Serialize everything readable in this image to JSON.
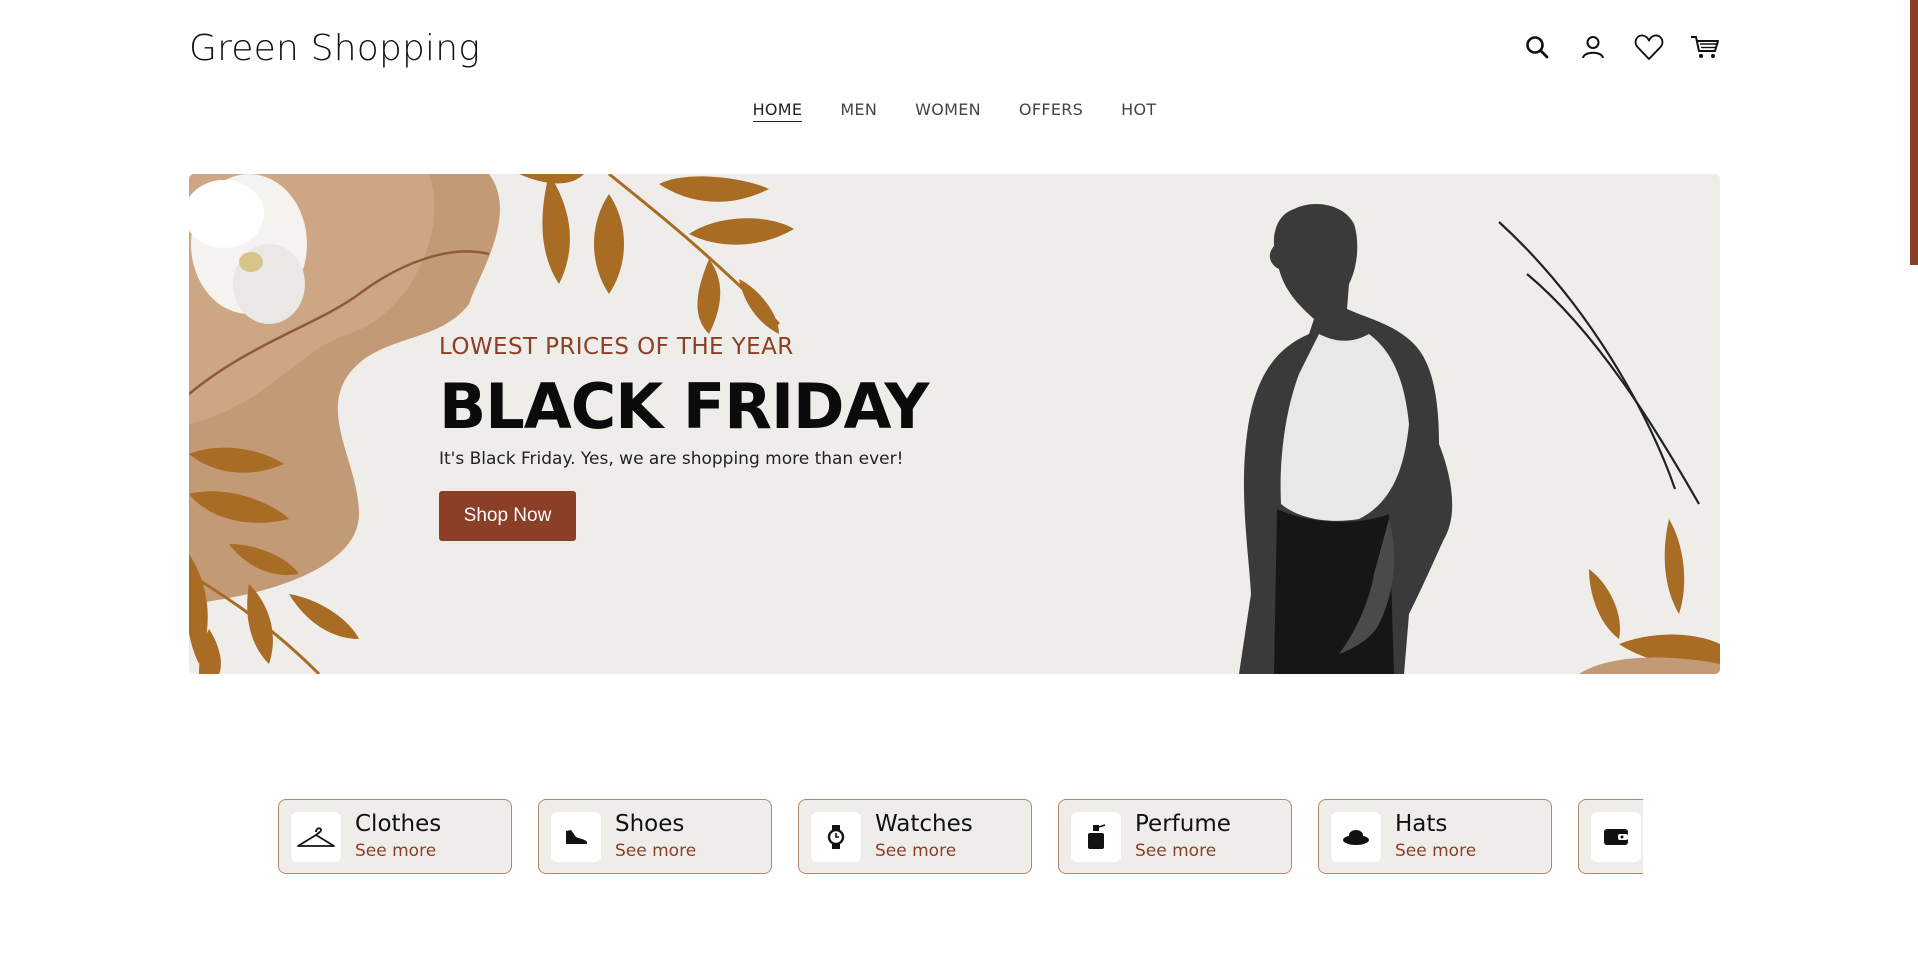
{
  "brand": {
    "name": "Green Shopping"
  },
  "header": {
    "icons": [
      "search-icon",
      "user-icon",
      "heart-icon",
      "cart-icon"
    ]
  },
  "nav": {
    "items": [
      {
        "label": "HOME",
        "active": true
      },
      {
        "label": "MEN"
      },
      {
        "label": "WOMEN"
      },
      {
        "label": "OFFERS"
      },
      {
        "label": "HOT"
      }
    ]
  },
  "hero": {
    "eyebrow": "LOWEST PRICES OF THE YEAR",
    "title": "BLACK FRIDAY",
    "subtitle": "It's Black Friday. Yes, we are shopping more than ever!",
    "cta_label": "Shop Now"
  },
  "categories": [
    {
      "name": "Clothes",
      "more": "See more",
      "icon": "hanger-icon"
    },
    {
      "name": "Shoes",
      "more": "See more",
      "icon": "shoe-icon"
    },
    {
      "name": "Watches",
      "more": "See more",
      "icon": "watch-icon"
    },
    {
      "name": "Perfume",
      "more": "See more",
      "icon": "perfume-icon"
    },
    {
      "name": "Hats",
      "more": "See more",
      "icon": "hat-icon"
    },
    {
      "name": "",
      "more": "",
      "icon": "wallet-icon"
    }
  ],
  "colors": {
    "accent": "#8a3f26",
    "hero_bg": "#efedea",
    "card_border": "#b5876b"
  }
}
